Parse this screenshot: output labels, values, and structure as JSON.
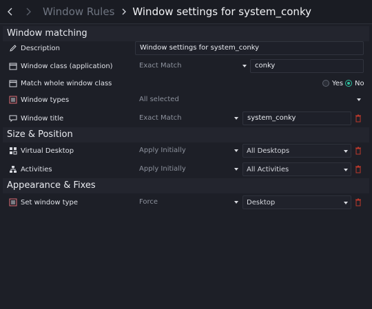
{
  "header": {
    "back_icon": "chevron-left-icon",
    "forward_icon": "chevron-right-icon",
    "parent": "Window Rules",
    "current": "Window settings for system_conky"
  },
  "sections": {
    "matching": "Window matching",
    "size": "Size & Position",
    "appearance": "Appearance & Fixes"
  },
  "rows": {
    "description": {
      "label": "Description",
      "value": "Window settings for system_conky",
      "icon": "pencil-icon"
    },
    "window_class": {
      "label": "Window class (application)",
      "match": "Exact Match",
      "value": "conky",
      "icon": "window-icon"
    },
    "whole_class": {
      "label": "Match whole window class",
      "yes": "Yes",
      "no": "No",
      "selected": "No",
      "icon": "window-icon"
    },
    "window_types": {
      "label": "Window types",
      "value": "All selected",
      "icon": "window-types-icon"
    },
    "window_title": {
      "label": "Window title",
      "match": "Exact Match",
      "value": "system_conky",
      "icon": "speech-bubble-icon"
    },
    "virtual_desktop": {
      "label": "Virtual Desktop",
      "policy": "Apply Initially",
      "value": "All Desktops",
      "icon": "desktop-grid-icon"
    },
    "activities": {
      "label": "Activities",
      "policy": "Apply Initially",
      "value": "All Activities",
      "icon": "activities-icon"
    },
    "set_window_type": {
      "label": "Set window type",
      "policy": "Force",
      "value": "Desktop",
      "icon": "window-types-icon"
    }
  },
  "colors": {
    "accent": "#2ec2a0",
    "delete": "#c0392b"
  }
}
